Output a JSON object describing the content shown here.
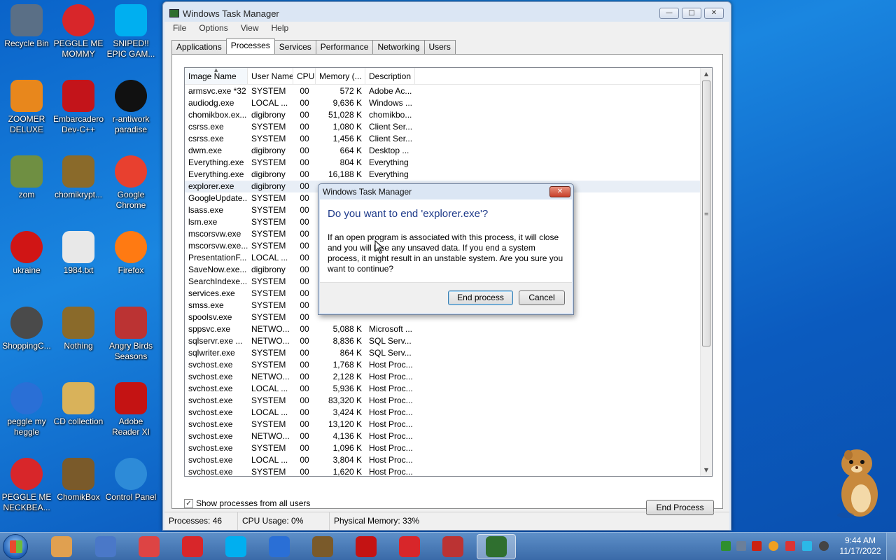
{
  "desktop": {
    "icons": [
      {
        "label": "Recycle Bin",
        "icon": "recycle-bin-icon",
        "color": "#5a6f86"
      },
      {
        "label": "PEGGLE ME MOMMY",
        "icon": "peggle-icon",
        "color": "#d8262a"
      },
      {
        "label": "SNIPED!! EPIC GAM...",
        "icon": "skype-icon",
        "color": "#00aff0"
      },
      {
        "label": "ZOOMER DELUXE",
        "icon": "zoomer-icon",
        "color": "#e8871c"
      },
      {
        "label": "Embarcadero Dev-C++",
        "icon": "devcpp-icon",
        "color": "#c3141a"
      },
      {
        "label": "r-antiwork paradise",
        "icon": "antiwork-icon",
        "color": "#111111"
      },
      {
        "label": "zom",
        "icon": "flower-icon",
        "color": "#6f8f42"
      },
      {
        "label": "chomikrypt...",
        "icon": "clock-app-icon",
        "color": "#8a6a2a"
      },
      {
        "label": "Google Chrome",
        "icon": "chrome-icon",
        "color": "#e8402f"
      },
      {
        "label": "ukraine",
        "icon": "radiation-icon",
        "color": "#d01515"
      },
      {
        "label": "1984.txt",
        "icon": "text-file-icon",
        "color": "#e8e8e8"
      },
      {
        "label": "Firefox",
        "icon": "firefox-icon",
        "color": "#ff7a12"
      },
      {
        "label": "ShoppingC...",
        "icon": "flash-icon",
        "color": "#4a4a4a"
      },
      {
        "label": "Nothing",
        "icon": "clock-app-icon",
        "color": "#8a6a2a"
      },
      {
        "label": "Angry Birds Seasons",
        "icon": "angry-birds-icon",
        "color": "#b33"
      },
      {
        "label": "peggle my heggle",
        "icon": "peggle-icon",
        "color": "#2a6fd6"
      },
      {
        "label": "CD collection",
        "icon": "cd-folder-icon",
        "color": "#d9b25a"
      },
      {
        "label": "Adobe Reader XI",
        "icon": "adobe-reader-icon",
        "color": "#c41313"
      },
      {
        "label": "PEGGLE ME NECKBEA...",
        "icon": "peggle-icon",
        "color": "#d8262a"
      },
      {
        "label": "ChomikBox",
        "icon": "chomikbox-icon",
        "color": "#7a5a2a"
      },
      {
        "label": "Control Panel",
        "icon": "control-panel-icon",
        "color": "#2d8bd8"
      }
    ]
  },
  "window": {
    "title": "Windows Task Manager",
    "menu": [
      "File",
      "Options",
      "View",
      "Help"
    ],
    "tabs": [
      "Applications",
      "Processes",
      "Services",
      "Performance",
      "Networking",
      "Users"
    ],
    "active_tab": "Processes",
    "columns": [
      "Image Name",
      "User Name",
      "CPU",
      "Memory (...",
      "Description"
    ],
    "rows": [
      {
        "name": "armsvc.exe *32",
        "user": "SYSTEM",
        "cpu": "00",
        "mem": "572 K",
        "desc": "Adobe Ac..."
      },
      {
        "name": "audiodg.exe",
        "user": "LOCAL ...",
        "cpu": "00",
        "mem": "9,636 K",
        "desc": "Windows ..."
      },
      {
        "name": "chomikbox.ex...",
        "user": "digibrony",
        "cpu": "00",
        "mem": "51,028 K",
        "desc": "chomikbo..."
      },
      {
        "name": "csrss.exe",
        "user": "SYSTEM",
        "cpu": "00",
        "mem": "1,080 K",
        "desc": "Client Ser..."
      },
      {
        "name": "csrss.exe",
        "user": "SYSTEM",
        "cpu": "00",
        "mem": "1,456 K",
        "desc": "Client Ser..."
      },
      {
        "name": "dwm.exe",
        "user": "digibrony",
        "cpu": "00",
        "mem": "664 K",
        "desc": "Desktop ..."
      },
      {
        "name": "Everything.exe",
        "user": "SYSTEM",
        "cpu": "00",
        "mem": "804 K",
        "desc": "Everything"
      },
      {
        "name": "Everything.exe",
        "user": "digibrony",
        "cpu": "00",
        "mem": "16,188 K",
        "desc": "Everything"
      },
      {
        "name": "explorer.exe",
        "user": "digibrony",
        "cpu": "00",
        "mem": "",
        "desc": ""
      },
      {
        "name": "GoogleUpdate...",
        "user": "SYSTEM",
        "cpu": "00",
        "mem": "",
        "desc": ""
      },
      {
        "name": "lsass.exe",
        "user": "SYSTEM",
        "cpu": "00",
        "mem": "",
        "desc": ""
      },
      {
        "name": "lsm.exe",
        "user": "SYSTEM",
        "cpu": "00",
        "mem": "",
        "desc": ""
      },
      {
        "name": "mscorsvw.exe",
        "user": "SYSTEM",
        "cpu": "00",
        "mem": "",
        "desc": ""
      },
      {
        "name": "mscorsvw.exe...",
        "user": "SYSTEM",
        "cpu": "00",
        "mem": "",
        "desc": ""
      },
      {
        "name": "PresentationF...",
        "user": "LOCAL ...",
        "cpu": "00",
        "mem": "",
        "desc": ""
      },
      {
        "name": "SaveNow.exe...",
        "user": "digibrony",
        "cpu": "00",
        "mem": "",
        "desc": ""
      },
      {
        "name": "SearchIndexe...",
        "user": "SYSTEM",
        "cpu": "00",
        "mem": "",
        "desc": ""
      },
      {
        "name": "services.exe",
        "user": "SYSTEM",
        "cpu": "00",
        "mem": "",
        "desc": ""
      },
      {
        "name": "smss.exe",
        "user": "SYSTEM",
        "cpu": "00",
        "mem": "",
        "desc": ""
      },
      {
        "name": "spoolsv.exe",
        "user": "SYSTEM",
        "cpu": "00",
        "mem": "",
        "desc": ""
      },
      {
        "name": "sppsvc.exe",
        "user": "NETWO...",
        "cpu": "00",
        "mem": "5,088 K",
        "desc": "Microsoft ..."
      },
      {
        "name": "sqlservr.exe ...",
        "user": "NETWO...",
        "cpu": "00",
        "mem": "8,836 K",
        "desc": "SQL Serv..."
      },
      {
        "name": "sqlwriter.exe",
        "user": "SYSTEM",
        "cpu": "00",
        "mem": "864 K",
        "desc": "SQL Serv..."
      },
      {
        "name": "svchost.exe",
        "user": "SYSTEM",
        "cpu": "00",
        "mem": "1,768 K",
        "desc": "Host Proc..."
      },
      {
        "name": "svchost.exe",
        "user": "NETWO...",
        "cpu": "00",
        "mem": "2,128 K",
        "desc": "Host Proc..."
      },
      {
        "name": "svchost.exe",
        "user": "LOCAL ...",
        "cpu": "00",
        "mem": "5,936 K",
        "desc": "Host Proc..."
      },
      {
        "name": "svchost.exe",
        "user": "SYSTEM",
        "cpu": "00",
        "mem": "83,320 K",
        "desc": "Host Proc..."
      },
      {
        "name": "svchost.exe",
        "user": "LOCAL ...",
        "cpu": "00",
        "mem": "3,424 K",
        "desc": "Host Proc..."
      },
      {
        "name": "svchost.exe",
        "user": "SYSTEM",
        "cpu": "00",
        "mem": "13,120 K",
        "desc": "Host Proc..."
      },
      {
        "name": "svchost.exe",
        "user": "NETWO...",
        "cpu": "00",
        "mem": "4,136 K",
        "desc": "Host Proc..."
      },
      {
        "name": "svchost.exe",
        "user": "SYSTEM",
        "cpu": "00",
        "mem": "1,096 K",
        "desc": "Host Proc..."
      },
      {
        "name": "svchost.exe",
        "user": "LOCAL ...",
        "cpu": "00",
        "mem": "3,804 K",
        "desc": "Host Proc..."
      },
      {
        "name": "svchost.exe",
        "user": "SYSTEM",
        "cpu": "00",
        "mem": "1,620 K",
        "desc": "Host Proc..."
      }
    ],
    "show_all_label": "Show processes from all users",
    "show_all_checked": true,
    "end_process_label": "End Process",
    "status": {
      "processes": "Processes: 46",
      "cpu": "CPU Usage: 0%",
      "memory": "Physical Memory: 33%"
    }
  },
  "dialog": {
    "title": "Windows Task Manager",
    "instruction": "Do you want to end 'explorer.exe'?",
    "text": "If an open program is associated with this process, it will close and you will lose any unsaved data. If you end a system process, it might result in an unstable system. Are you sure you want to continue?",
    "confirm_label": "End process",
    "cancel_label": "Cancel"
  },
  "taskbar": {
    "items": [
      {
        "icon": "paint-icon",
        "color": "#e0a050"
      },
      {
        "icon": "remote-desktop-icon",
        "color": "#4a78c8"
      },
      {
        "icon": "snipping-tool-icon",
        "color": "#d44"
      },
      {
        "icon": "peggle-icon",
        "color": "#d8262a"
      },
      {
        "icon": "skype-icon",
        "color": "#00aff0"
      },
      {
        "icon": "peggle-icon",
        "color": "#2a6fd6"
      },
      {
        "icon": "chomikbox-icon",
        "color": "#7a5a2a"
      },
      {
        "icon": "adobe-reader-icon",
        "color": "#c41313"
      },
      {
        "icon": "peggle-icon",
        "color": "#d8262a"
      },
      {
        "icon": "angry-birds-icon",
        "color": "#b33"
      },
      {
        "icon": "task-manager-icon",
        "color": "#2f6f2f"
      }
    ],
    "time": "9:44 AM",
    "date": "11/17/2022"
  }
}
